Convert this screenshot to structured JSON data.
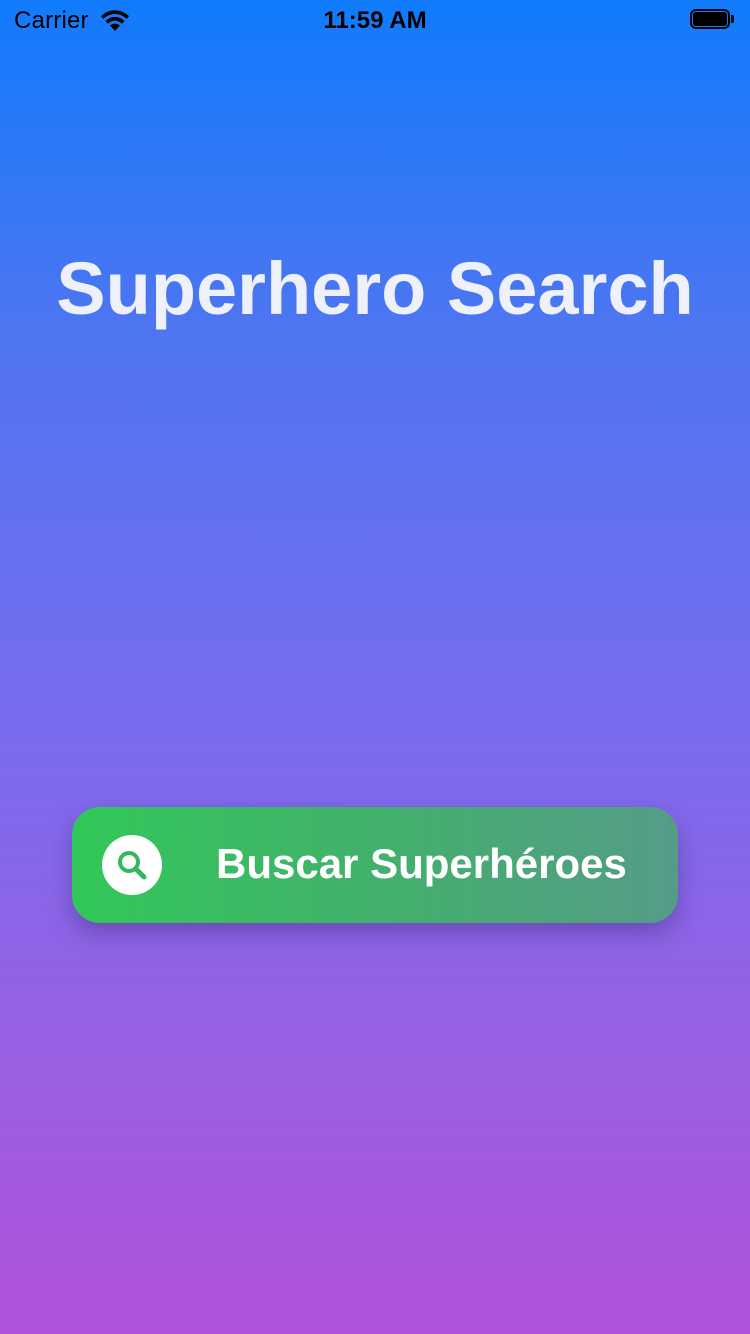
{
  "status_bar": {
    "carrier": "Carrier",
    "time": "11:59 AM",
    "wifi_icon": "wifi-icon",
    "battery_icon": "battery-icon"
  },
  "main": {
    "title": "Superhero Search",
    "search_button": {
      "label": "Buscar Superhéroes",
      "icon": "search-icon"
    }
  },
  "colors": {
    "gradient_top": "#107bfc",
    "gradient_bottom": "#b052dc",
    "button_start": "#32c759",
    "button_end": "#559c88",
    "title": "#eef0fb"
  }
}
